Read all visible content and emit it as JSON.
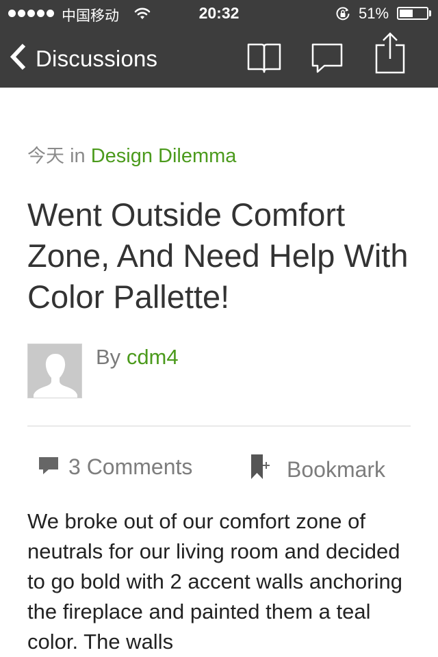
{
  "status_bar": {
    "carrier": "中国移动",
    "time": "20:32",
    "battery": "51%",
    "battery_level": 0.51,
    "signal_bars": 5
  },
  "nav": {
    "back_label": "Discussions",
    "icons": [
      "book-icon",
      "speech-bubble-icon",
      "share-icon"
    ]
  },
  "post": {
    "day": "今天",
    "in_word": "in",
    "category": "Design Dilemma",
    "title": "Went Outside Comfort Zone, And Need Help With Color Pallette!",
    "by_word": "By",
    "author": "cdm4"
  },
  "actions": {
    "comments_label": "3 Comments",
    "bookmark_label": "Bookmark"
  },
  "body": {
    "text": "We broke out of our comfort zone of neutrals for our living room and decided to go bold with 2 accent walls anchoring the fireplace and painted them a teal color. The walls"
  },
  "colors": {
    "bar_bg": "#3d3d3d",
    "accent_green": "#4b9a1c",
    "muted_gray": "#8a8a8a"
  }
}
